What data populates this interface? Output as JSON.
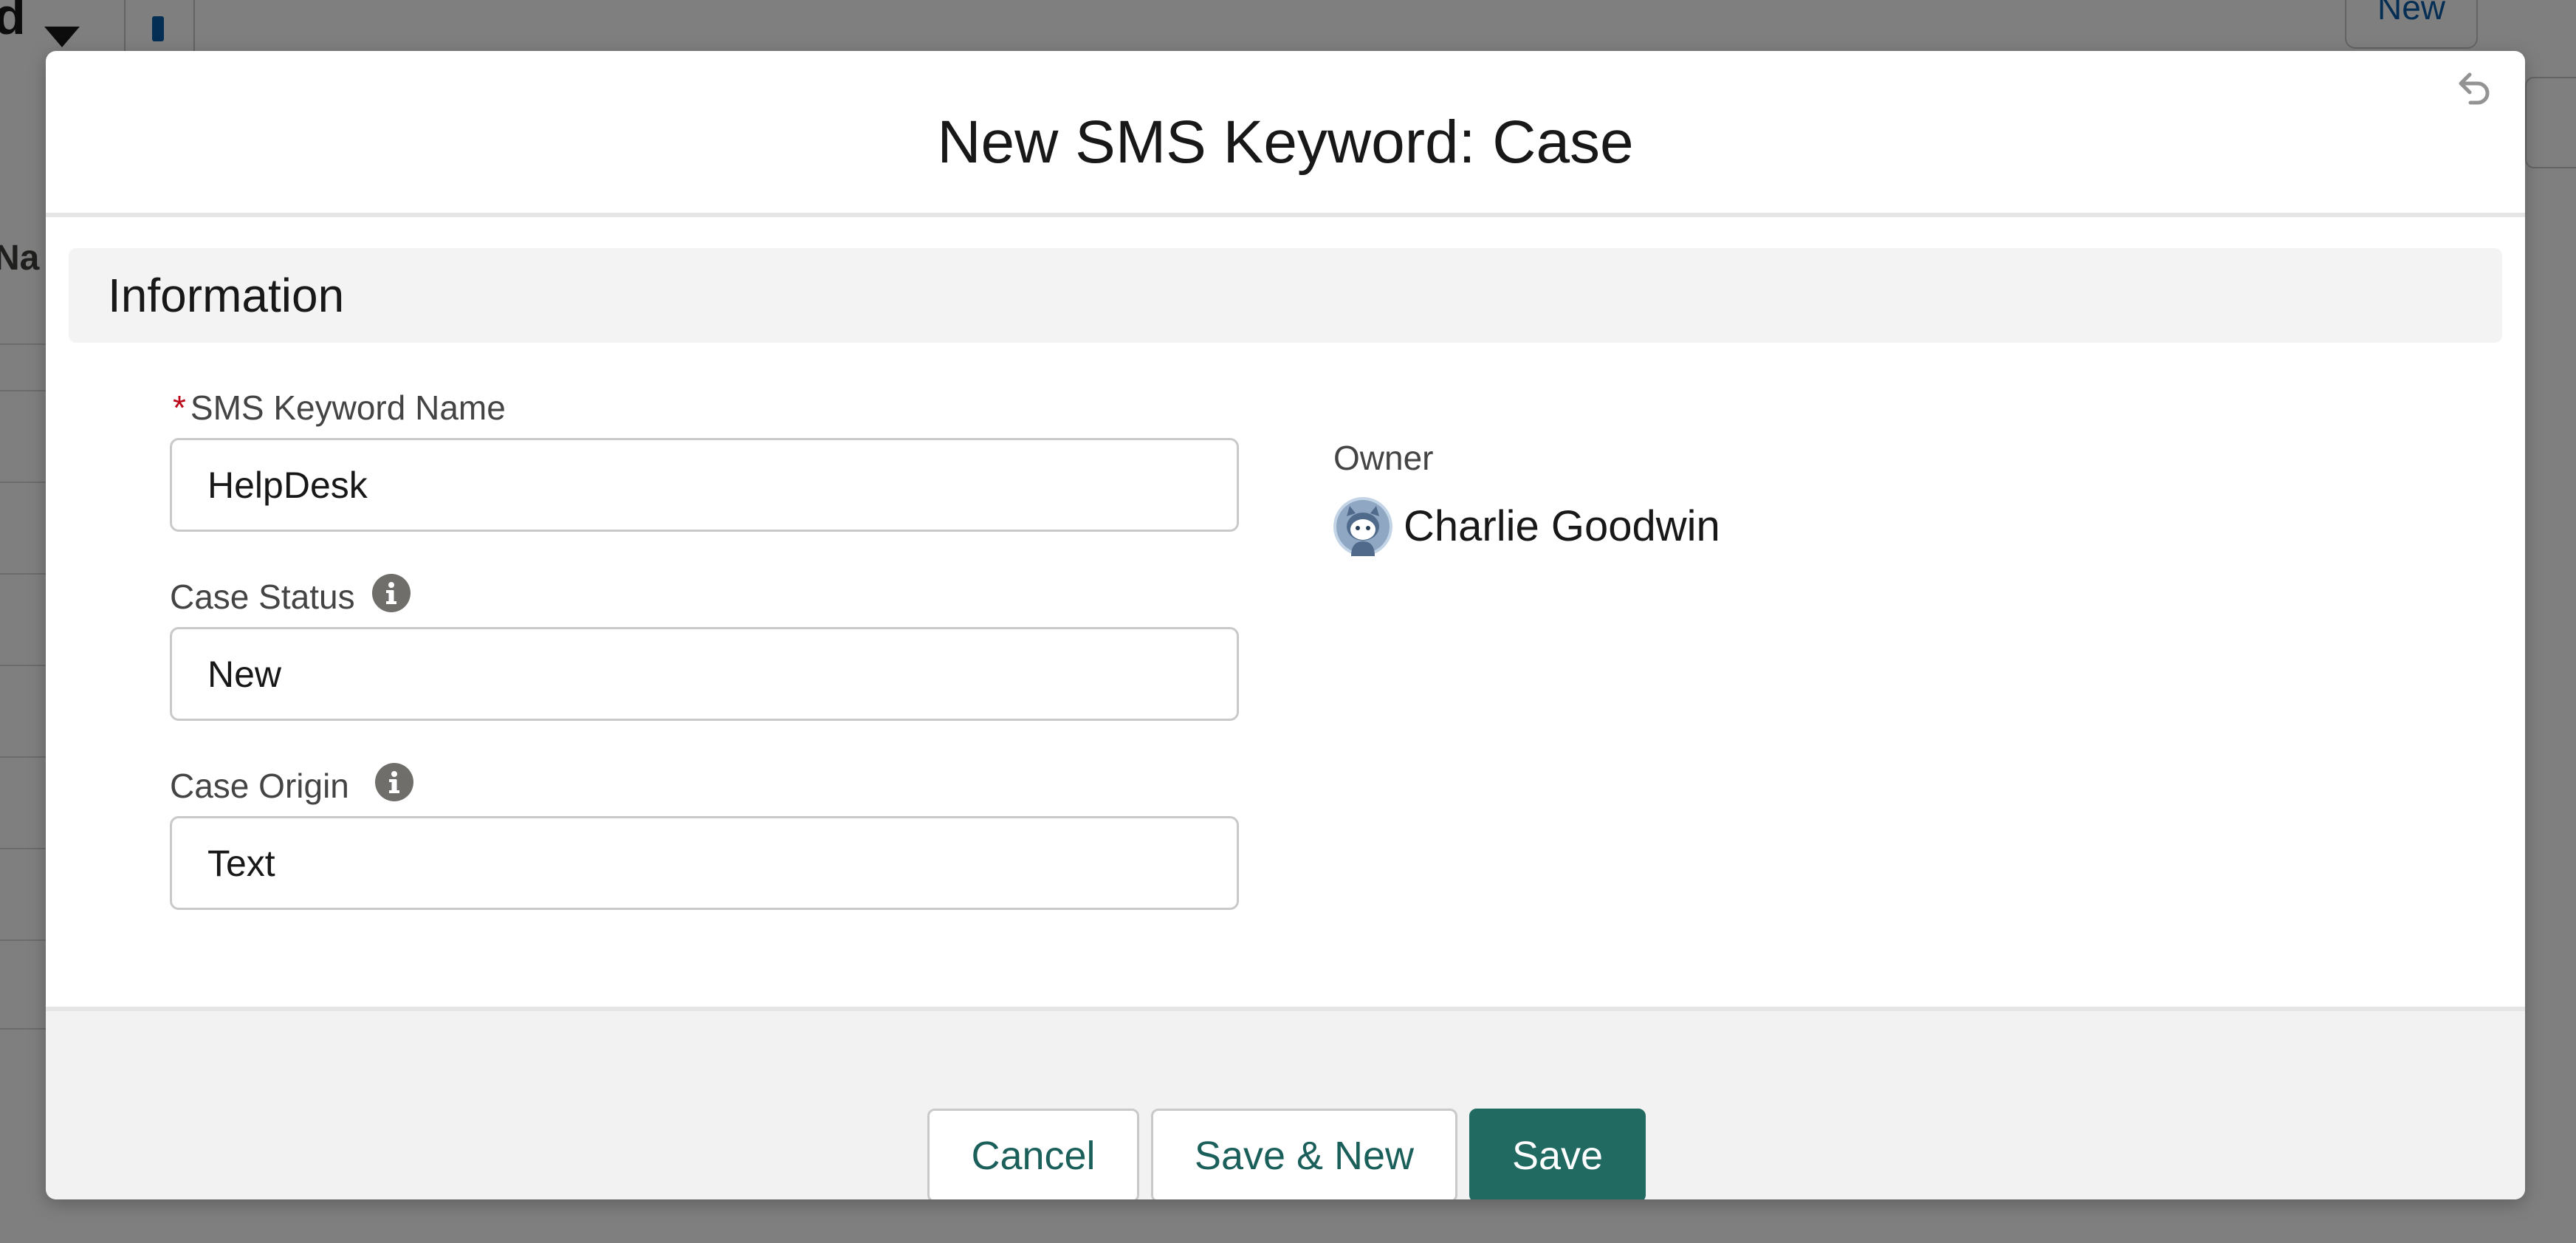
{
  "background": {
    "title_fragment": "d",
    "new_button_label": "New",
    "column_header_fragment": "Na"
  },
  "modal": {
    "title": "New SMS Keyword: Case",
    "section_title": "Information",
    "fields": {
      "sms_keyword_name": {
        "label": "SMS Keyword Name",
        "required_marker": "*",
        "value": "HelpDesk"
      },
      "case_status": {
        "label": "Case Status",
        "value": "New"
      },
      "case_origin": {
        "label": "Case Origin",
        "value": "Text"
      },
      "owner": {
        "label": "Owner",
        "name": "Charlie Goodwin"
      }
    },
    "buttons": {
      "cancel": "Cancel",
      "save_and_new": "Save & New",
      "save": "Save"
    }
  },
  "colors": {
    "brand_button": "#206a62",
    "required_star": "#ba0517",
    "section_background": "#f3f3f3",
    "footer_background": "#f3f2f2"
  },
  "icons": {
    "header": "undo-icon",
    "field_help": "info-icon",
    "owner": "avatar"
  }
}
